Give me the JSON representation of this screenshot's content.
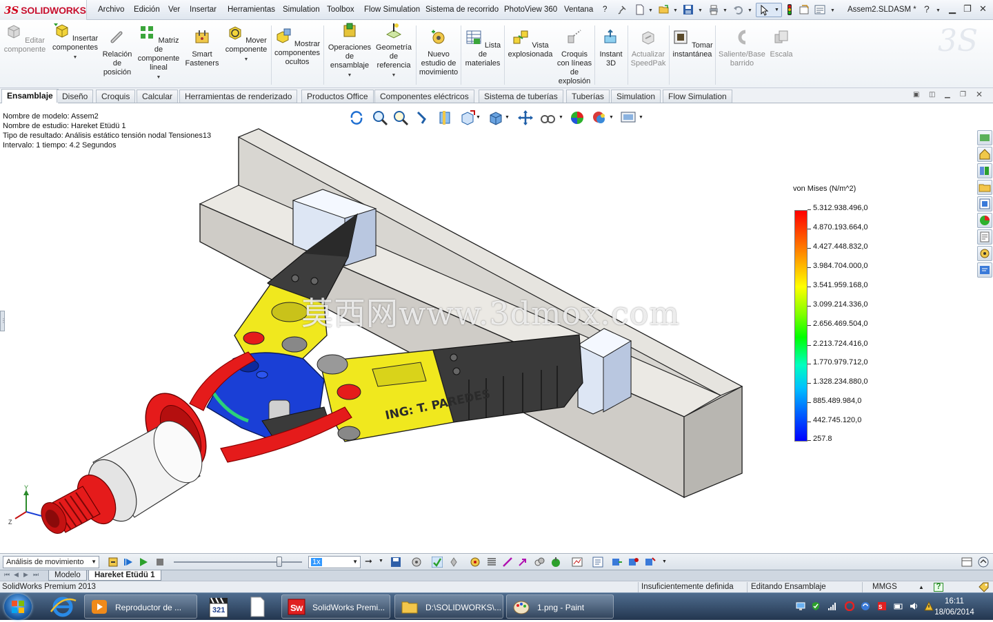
{
  "app": {
    "logo_prefix": "3S",
    "logo_text": "SOLIDWORKS",
    "document_title": "Assem2.SLDASM *",
    "help": "?"
  },
  "menu": [
    "Archivo",
    "Edición",
    "Ver",
    "Insertar",
    "Herramientas",
    "Simulation",
    "Toolbox",
    "Flow Simulation",
    "Sistema de recorrido",
    "PhotoView 360",
    "Ventana",
    "?"
  ],
  "ribbon": [
    {
      "label": "Editar componente",
      "icon": "edit-component-icon",
      "enabled": false
    },
    {
      "label": "Insertar componentes",
      "icon": "insert-components-icon",
      "enabled": true,
      "dropdown": true
    },
    {
      "label": "Relación de posición",
      "icon": "mate-icon",
      "enabled": true
    },
    {
      "label": "Matriz de componente lineal",
      "icon": "linear-pattern-icon",
      "enabled": true,
      "dropdown": true
    },
    {
      "label": "Smart Fasteners",
      "icon": "smart-fasteners-icon",
      "enabled": true
    },
    {
      "label": "Mover componente",
      "icon": "move-component-icon",
      "enabled": true,
      "dropdown": true
    },
    {
      "label": "Mostrar componentes ocultos",
      "icon": "show-hidden-icon",
      "enabled": true
    },
    {
      "label": "Operaciones de ensamblaje",
      "icon": "assembly-features-icon",
      "enabled": true,
      "dropdown": true
    },
    {
      "label": "Geometría de referencia",
      "icon": "reference-geometry-icon",
      "enabled": true,
      "dropdown": true
    },
    {
      "label": "Nuevo estudio de movimiento",
      "icon": "new-motion-study-icon",
      "enabled": true
    },
    {
      "label": "Lista de materiales",
      "icon": "bill-of-materials-icon",
      "enabled": true
    },
    {
      "label": "Vista explosionada",
      "icon": "exploded-view-icon",
      "enabled": true
    },
    {
      "label": "Croquis con líneas de explosión",
      "icon": "explode-line-sketch-icon",
      "enabled": true
    },
    {
      "label": "Instant 3D",
      "icon": "instant-3d-icon",
      "enabled": true
    },
    {
      "label": "Actualizar SpeedPak",
      "icon": "speedpak-icon",
      "enabled": false
    },
    {
      "label": "Tomar instantánea",
      "icon": "snapshot-icon",
      "enabled": true
    },
    {
      "label": "Saliente/Base barrido",
      "icon": "sweep-icon",
      "enabled": false
    },
    {
      "label": "Escala",
      "icon": "scale-icon",
      "enabled": false
    }
  ],
  "tabs": [
    "Ensamblaje",
    "Diseño",
    "Croquis",
    "Calcular",
    "Herramientas de renderizado",
    "Productos Office",
    "Componentes eléctricos",
    "Sistema de tuberías",
    "Tuberías",
    "Simulation",
    "Flow Simulation"
  ],
  "active_tab": "Ensamblaje",
  "info": {
    "model_name": "Nombre de modelo: Assem2",
    "study_name": "Nombre de estudio: Hareket Etüdü 1",
    "result_type": "Tipo de resultado: Análisis estático tensión nodal Tensiones13",
    "interval": "Intervalo: 1   tiempo: 4.2 Segundos"
  },
  "legend": {
    "title": "von Mises (N/m^2)",
    "values": [
      "5.312.938.496,0",
      "4.870.193.664,0",
      "4.427.448.832,0",
      "3.984.704.000,0",
      "3.541.959.168,0",
      "3.099.214.336,0",
      "2.656.469.504,0",
      "2.213.724.416,0",
      "1.770.979.712,0",
      "1.328.234.880,0",
      "885.489.984,0",
      "442.745.120,0",
      "257.8"
    ],
    "colors": [
      "#ff0000",
      "#ff8000",
      "#ffff00",
      "#00ff00",
      "#00ffc0",
      "#0060ff",
      "#0000ff"
    ]
  },
  "model": {
    "engraving": "ING: T. PAREDES",
    "watermark": "莫西网www.3dmox.com",
    "axis_labels": {
      "y": "Y",
      "z": "Z"
    }
  },
  "motion": {
    "study_type": "Análisis de movimiento",
    "speed": "1x",
    "timeline_position": 0.82
  },
  "bottom_tabs": [
    "Modelo",
    "Hareket Etüdü 1"
  ],
  "active_bottom_tab": "Hareket Etüdü 1",
  "status": {
    "product": "SolidWorks Premium 2013",
    "definition": "Insuficientemente definida",
    "mode": "Editando Ensamblaje",
    "units": "MMGS",
    "help": "?"
  },
  "taskbar": {
    "tasks": [
      "Reproductor de ...",
      "SolidWorks Premi...",
      "D:\\SOLIDWORKS\\...",
      "1.png - Paint"
    ],
    "pinned_badge": "321",
    "time": "16:11",
    "date": "18/06/2014"
  },
  "colors": {
    "accent": "#c8102e",
    "yellow_part": "#f0e81e",
    "red_part": "#e51b1b",
    "blue_part": "#1a3fd6"
  }
}
